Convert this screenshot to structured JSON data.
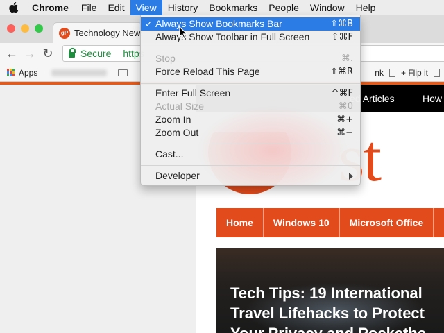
{
  "menubar": {
    "app_name": "Chrome",
    "items": [
      "File",
      "Edit",
      "View",
      "History",
      "Bookmarks",
      "People",
      "Window",
      "Help"
    ],
    "active_item": "View"
  },
  "browser": {
    "tab_title": "Technology News",
    "favicon_text": "gP",
    "secure_label": "Secure",
    "url_fragment": "https",
    "bookmarks": {
      "apps_label": "Apps",
      "right_items": [
        "nk",
        "+ Flip it"
      ]
    }
  },
  "view_menu": {
    "groups": [
      [
        {
          "label": "Always Show Bookmarks Bar",
          "shortcut": "⇧⌘B",
          "checked": true,
          "highlighted": true,
          "enabled": true
        },
        {
          "label": "Always Show Toolbar in Full Screen",
          "shortcut": "⇧⌘F",
          "checked": false,
          "highlighted": false,
          "enabled": true
        }
      ],
      [
        {
          "label": "Stop",
          "shortcut": "⌘.",
          "enabled": false
        },
        {
          "label": "Force Reload This Page",
          "shortcut": "⇧⌘R",
          "enabled": true
        }
      ],
      [
        {
          "label": "Enter Full Screen",
          "shortcut": "^⌘F",
          "enabled": true
        },
        {
          "label": "Actual Size",
          "shortcut": "⌘0",
          "enabled": false
        },
        {
          "label": "Zoom In",
          "shortcut": "⌘+",
          "enabled": true
        },
        {
          "label": "Zoom Out",
          "shortcut": "⌘−",
          "enabled": true
        }
      ],
      [
        {
          "label": "Cast...",
          "shortcut": "",
          "enabled": true
        }
      ],
      [
        {
          "label": "Developer",
          "shortcut": "",
          "enabled": true,
          "submenu": true
        }
      ]
    ]
  },
  "page": {
    "top_nav": [
      "ed Articles",
      "How"
    ],
    "logo_text": "st",
    "main_nav": [
      "Home",
      "Windows 10",
      "Microsoft Office"
    ],
    "headline_lines": [
      "Tech Tips: 19 International",
      "Travel Lifehacks to Protect",
      "Your Privacy and Pockethe"
    ]
  },
  "colors": {
    "accent": "#2b7ce4",
    "brand": "#e24b1c",
    "secure_green": "#1e8e3e"
  }
}
